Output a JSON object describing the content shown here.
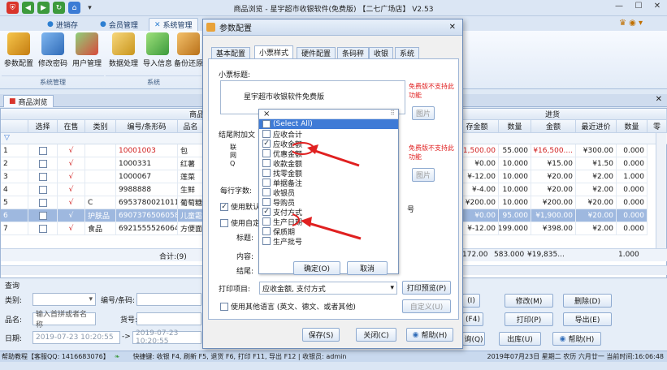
{
  "window": {
    "title": "商品浏览 - 星宇超市收银软件(免费版) 【二七广场店】  V2.53",
    "min": "—",
    "max": "☐",
    "close": "✕"
  },
  "ribbon": {
    "tabs": [
      "进销存",
      "会员管理",
      "系统管理"
    ],
    "buttons": [
      "参数配置",
      "修改密码",
      "用户管理",
      "数据处理",
      "导入信息",
      "备份还原"
    ],
    "groups": [
      "系统管理",
      "系统"
    ]
  },
  "doc_tab": "商品浏览",
  "grid": {
    "group_headers": [
      "商品",
      "进货"
    ],
    "headers": [
      "选择",
      "在售",
      "类别",
      "编号/条形码",
      "品名"
    ],
    "right_headers": [
      "存金额",
      "数量",
      "金额",
      "最近进价",
      "数量",
      "零"
    ],
    "rows": [
      {
        "n": "1",
        "ok": "√",
        "cat": "",
        "code": "10001003",
        "name": "包",
        "v1": "1,500.00",
        "v2": "55.000",
        "v3": "¥16,500....",
        "v4": "¥300.00",
        "v5": "0.000",
        "red": true
      },
      {
        "n": "2",
        "ok": "√",
        "cat": "",
        "code": "1000331",
        "name": "红薯",
        "v1": "¥0.00",
        "v2": "10.000",
        "v3": "¥15.00",
        "v4": "¥1.50",
        "v5": "0.000",
        "red": false
      },
      {
        "n": "3",
        "ok": "√",
        "cat": "",
        "code": "1000067",
        "name": "莲菜",
        "v1": "¥-12.00",
        "v2": "10.000",
        "v3": "¥20.00",
        "v4": "¥2.00",
        "v5": "1.000",
        "red": false
      },
      {
        "n": "4",
        "ok": "√",
        "cat": "",
        "code": "9988888",
        "name": "生鲜",
        "v1": "¥-4.00",
        "v2": "10.000",
        "v3": "¥20.00",
        "v4": "¥2.00",
        "v5": "0.000",
        "red": false
      },
      {
        "n": "5",
        "ok": "√",
        "cat": "C",
        "code": "6953780021011",
        "name": "葡萄糖",
        "v1": "¥200.00",
        "v2": "10.000",
        "v3": "¥200.00",
        "v4": "¥20.00",
        "v5": "0.000",
        "red": false
      },
      {
        "n": "6",
        "ok": "√",
        "cat": "护肤品",
        "code": "6907376506058",
        "name": "儿童霜",
        "v1": "¥0.00",
        "v2": "95.000",
        "v3": "¥1,900.00",
        "v4": "¥20.00",
        "v5": "0.000",
        "red": false
      },
      {
        "n": "7",
        "ok": "√",
        "cat": "食品",
        "code": "6921555526064",
        "name": "方便面",
        "v1": "¥-12.00",
        "v2": "199.000",
        "v3": "¥398.00",
        "v4": "¥2.00",
        "v5": "0.000",
        "red": false
      }
    ],
    "total_label": "合计:(9)",
    "totals": [
      "172.00",
      "583.000",
      "¥19,835...",
      "1.000"
    ]
  },
  "query": {
    "title": "查询",
    "category_label": "类别:",
    "code_label": "编号/条码:",
    "name_label": "品名:",
    "name_placeholder": "输入首拼或者名称",
    "goods_no_label": "货号:",
    "date_label": "日期:",
    "date_from": "2019-07-23 10:20:55",
    "date_to": "2019-07-23 10:20:55",
    "right_buttons": [
      "(I)",
      "修改(M)",
      "删除(D)",
      "(F4)",
      "打印(P)",
      "导出(E)",
      "询(Q)",
      "出库(U)",
      "帮助(H)"
    ]
  },
  "status": {
    "left": "帮助教程【客服QQ: 1416683076】",
    "mid": "快捷键: 收银 F4, 刷新 F5, 退货 F6, 打印 F11, 导出 F12 | 收银员: admin",
    "right": "2019年07月23日 星期二 农历 六月廿一  当前时间:16:06:48"
  },
  "dialog": {
    "title": "参数配置",
    "tabs": [
      "基本配置",
      "小票样式",
      "硬件配置",
      "条码秤",
      "收银",
      "系统"
    ],
    "receipt_title_label": "小票标题:",
    "receipt_title_value": "星宇超市收银软件免费版",
    "free_note": "免费版不支持此功能",
    "image_btn": "图片",
    "tail_label": "结尾附加文",
    "line_chars_label": "每行字数:",
    "use_default": "使用默认",
    "use_custom": "使用自定",
    "title_label": "标题:",
    "content_label": "内容:",
    "tail_label2": "结尾:",
    "hao": "号",
    "print_items_label": "打印项目:",
    "print_items_value": "应收金额, 支付方式",
    "print_preview_btn": "打印预览(P)",
    "other_lang": "使用其他语言 (英文、德文、或者其他)",
    "custom_btn": "自定义(U)",
    "save_btn": "保存(S)",
    "close_btn": "关闭(C)",
    "help_btn": "帮助(H)"
  },
  "dropdown": {
    "close": "×",
    "items": [
      {
        "label": "(Select All)",
        "checked": false,
        "hl": true
      },
      {
        "label": "应收合计",
        "checked": false,
        "hl": false
      },
      {
        "label": "应收金额",
        "checked": true,
        "hl": false
      },
      {
        "label": "优惠金额",
        "checked": false,
        "hl": false
      },
      {
        "label": "收款金额",
        "checked": false,
        "hl": false
      },
      {
        "label": "找零金额",
        "checked": false,
        "hl": false
      },
      {
        "label": "单据备注",
        "checked": false,
        "hl": false
      },
      {
        "label": "收银员",
        "checked": false,
        "hl": false
      },
      {
        "label": "导购员",
        "checked": false,
        "hl": false
      },
      {
        "label": "支付方式",
        "checked": true,
        "hl": false
      },
      {
        "label": "生产日期",
        "checked": false,
        "hl": false
      },
      {
        "label": "保质期",
        "checked": false,
        "hl": false
      },
      {
        "label": "生产批号",
        "checked": false,
        "hl": false
      }
    ],
    "ok": "确定(O)",
    "cancel": "取消"
  }
}
